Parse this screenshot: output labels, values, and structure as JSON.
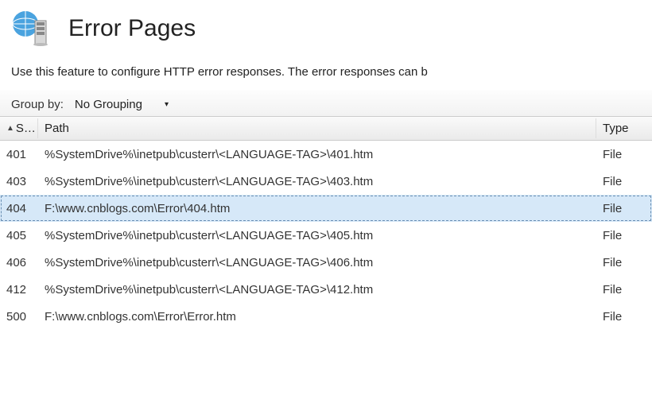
{
  "header": {
    "title": "Error Pages"
  },
  "description": "Use this feature to configure HTTP error responses. The error responses can b",
  "group_bar": {
    "label": "Group by:",
    "selected": "No Grouping"
  },
  "columns": {
    "status": "S…",
    "path": "Path",
    "type": "Type"
  },
  "rows": [
    {
      "status": "401",
      "path": "%SystemDrive%\\inetpub\\custerr\\<LANGUAGE-TAG>\\401.htm",
      "type": "File",
      "selected": false
    },
    {
      "status": "403",
      "path": "%SystemDrive%\\inetpub\\custerr\\<LANGUAGE-TAG>\\403.htm",
      "type": "File",
      "selected": false
    },
    {
      "status": "404",
      "path": "F:\\www.cnblogs.com\\Error\\404.htm",
      "type": "File",
      "selected": true
    },
    {
      "status": "405",
      "path": "%SystemDrive%\\inetpub\\custerr\\<LANGUAGE-TAG>\\405.htm",
      "type": "File",
      "selected": false
    },
    {
      "status": "406",
      "path": "%SystemDrive%\\inetpub\\custerr\\<LANGUAGE-TAG>\\406.htm",
      "type": "File",
      "selected": false
    },
    {
      "status": "412",
      "path": "%SystemDrive%\\inetpub\\custerr\\<LANGUAGE-TAG>\\412.htm",
      "type": "File",
      "selected": false
    },
    {
      "status": "500",
      "path": "F:\\www.cnblogs.com\\Error\\Error.htm",
      "type": "File",
      "selected": false
    }
  ]
}
